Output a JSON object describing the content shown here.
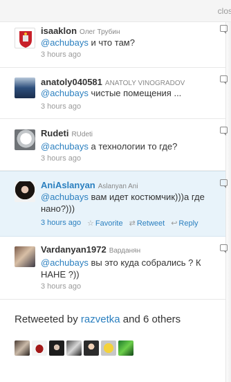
{
  "topbar": {
    "close_label": "clos"
  },
  "tweets": [
    {
      "username": "isaaklon",
      "fullname": "Олег Трубин",
      "mention": "@achubays",
      "text": " и что там?",
      "time": "3 hours ago"
    },
    {
      "username": "anatoly040581",
      "fullname": "ANATOLY VINOGRADOV",
      "mention": "@achubays",
      "text": " чистые помещения ...",
      "time": "3 hours ago"
    },
    {
      "username": "Rudeti",
      "fullname": "RUdeti",
      "mention": "@achubays",
      "text": " а технологии то где?",
      "time": "3 hours ago"
    },
    {
      "username": "AniAslanyan",
      "fullname": "Aslanyan Ani",
      "mention": "@achubays",
      "text": " вам идет костюмчик)))а где нано?)))",
      "time": "3 hours ago",
      "actions": {
        "favorite": "Favorite",
        "retweet": "Retweet",
        "reply": "Reply"
      }
    },
    {
      "username": "Vardanyan1972",
      "fullname": "Варданян",
      "mention": "@achubays",
      "text": " вы это куда собрались ? К НАНЕ ?))",
      "time": "3 hours ago"
    }
  ],
  "retweeted": {
    "prefix": "Retweeted by ",
    "user": "razvetka",
    "suffix": " and 6 others"
  },
  "icons": {
    "reply": "reply-icon",
    "favorite": "star-icon",
    "retweet": "retweet-icon",
    "reply_arrow": "reply-arrow-icon"
  },
  "colors": {
    "link": "#2a7fbf",
    "highlight_bg": "#e8f3fa"
  }
}
